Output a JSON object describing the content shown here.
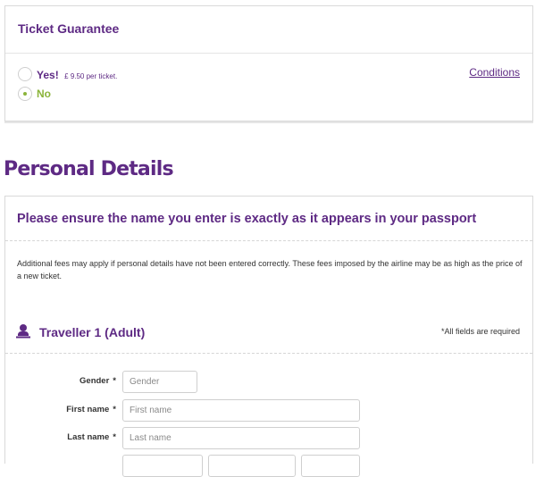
{
  "ticket_guarantee": {
    "title": "Ticket Guarantee",
    "yes_label": "Yes!",
    "yes_price": "£ 9.50 per ticket.",
    "no_label": "No",
    "conditions_link": "Conditions",
    "selected": "No"
  },
  "personal_details": {
    "heading": "Personal Details",
    "passport_notice": "Please ensure the name you enter is exactly as it appears in your passport",
    "fees_note": "Additional fees may apply if personal details have not been entered correctly. These fees imposed by the airline may be as high as the price of a new ticket.",
    "traveller": {
      "title": "Traveller 1 (Adult)",
      "required_note": "*All fields are required",
      "fields": {
        "gender": {
          "label": "Gender",
          "placeholder": "Gender"
        },
        "first_name": {
          "label": "First name",
          "placeholder": "First name"
        },
        "last_name": {
          "label": "Last name",
          "placeholder": "Last name"
        }
      },
      "required_marker": "*"
    }
  },
  "colors": {
    "brand_purple": "#5e2a84",
    "accent_green": "#8bb43a"
  },
  "icons": {
    "traveller": "person-icon"
  }
}
